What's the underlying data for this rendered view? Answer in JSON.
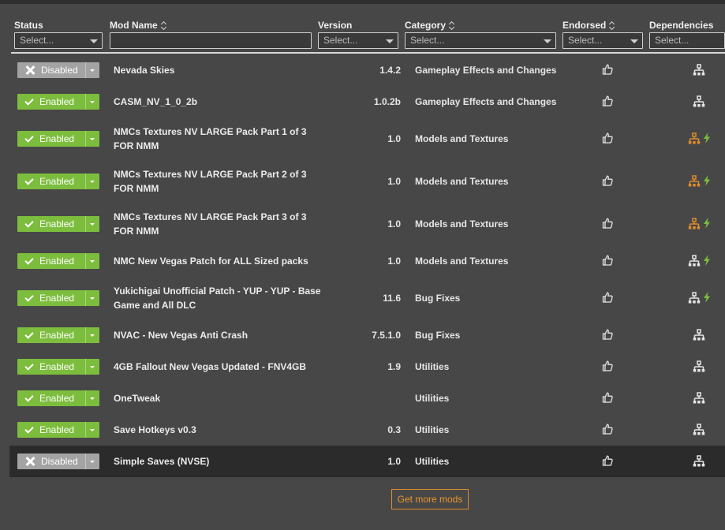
{
  "header": {
    "columns": {
      "status": "Status",
      "mod_name": "Mod Name",
      "version": "Version",
      "category": "Category",
      "endorsed": "Endorsed",
      "dependencies": "Dependencies"
    },
    "filters": {
      "status_placeholder": "Select...",
      "mod_name_value": "",
      "version_placeholder": "Select...",
      "category_placeholder": "Select...",
      "endorsed_placeholder": "Select...",
      "dependencies_placeholder": "Select..."
    }
  },
  "colors": {
    "enabled": "#7cbd3d",
    "disabled": "#a3a3a3",
    "dep_warning": "#e08b2c",
    "dep_bolt": "#7cbd3d",
    "accent": "#e08b2c"
  },
  "mods": [
    {
      "status": "Disabled",
      "enabled": false,
      "name_line1": "Nevada Skies",
      "name_line2": "",
      "version": "1.4.2",
      "category": "Gameplay Effects and Changes",
      "dep": "normal"
    },
    {
      "status": "Enabled",
      "enabled": true,
      "name_line1": "CASM_NV_1_0_2b",
      "name_line2": "",
      "version": "1.0.2b",
      "category": "Gameplay Effects and Changes",
      "dep": "normal"
    },
    {
      "status": "Enabled",
      "enabled": true,
      "name_line1": "NMCs Textures NV LARGE Pack Part 1 of 3",
      "name_line2": "FOR NMM",
      "version": "1.0",
      "category": "Models and Textures",
      "dep": "warning"
    },
    {
      "status": "Enabled",
      "enabled": true,
      "name_line1": "NMCs Textures NV LARGE Pack Part 2 of 3",
      "name_line2": "FOR NMM",
      "version": "1.0",
      "category": "Models and Textures",
      "dep": "warning"
    },
    {
      "status": "Enabled",
      "enabled": true,
      "name_line1": "NMCs Textures NV LARGE Pack Part 3 of 3",
      "name_line2": "FOR NMM",
      "version": "1.0",
      "category": "Models and Textures",
      "dep": "warning"
    },
    {
      "status": "Enabled",
      "enabled": true,
      "name_line1": "NMC New Vegas Patch for ALL Sized packs",
      "name_line2": "",
      "version": "1.0",
      "category": "Models and Textures",
      "dep": "bolt"
    },
    {
      "status": "Enabled",
      "enabled": true,
      "name_line1": "Yukichigai Unofficial Patch - YUP - YUP - Base",
      "name_line2": "Game and All DLC",
      "version": "11.6",
      "category": "Bug Fixes",
      "dep": "bolt"
    },
    {
      "status": "Enabled",
      "enabled": true,
      "name_line1": "NVAC - New Vegas Anti Crash",
      "name_line2": "",
      "version": "7.5.1.0",
      "category": "Bug Fixes",
      "dep": "normal"
    },
    {
      "status": "Enabled",
      "enabled": true,
      "name_line1": "4GB Fallout New Vegas Updated - FNV4GB",
      "name_line2": "",
      "version": "1.9",
      "category": "Utilities",
      "dep": "normal"
    },
    {
      "status": "Enabled",
      "enabled": true,
      "name_line1": "OneTweak",
      "name_line2": "",
      "version": "",
      "category": "Utilities",
      "dep": "normal"
    },
    {
      "status": "Enabled",
      "enabled": true,
      "name_line1": "Save Hotkeys v0.3",
      "name_line2": "",
      "version": "0.3",
      "category": "Utilities",
      "dep": "normal"
    },
    {
      "status": "Disabled",
      "enabled": false,
      "name_line1": "Simple Saves (NVSE)",
      "name_line2": "",
      "version": "1.0",
      "category": "Utilities",
      "dep": "normal",
      "selected": true
    }
  ],
  "footer": {
    "get_more_mods": "Get more mods"
  }
}
